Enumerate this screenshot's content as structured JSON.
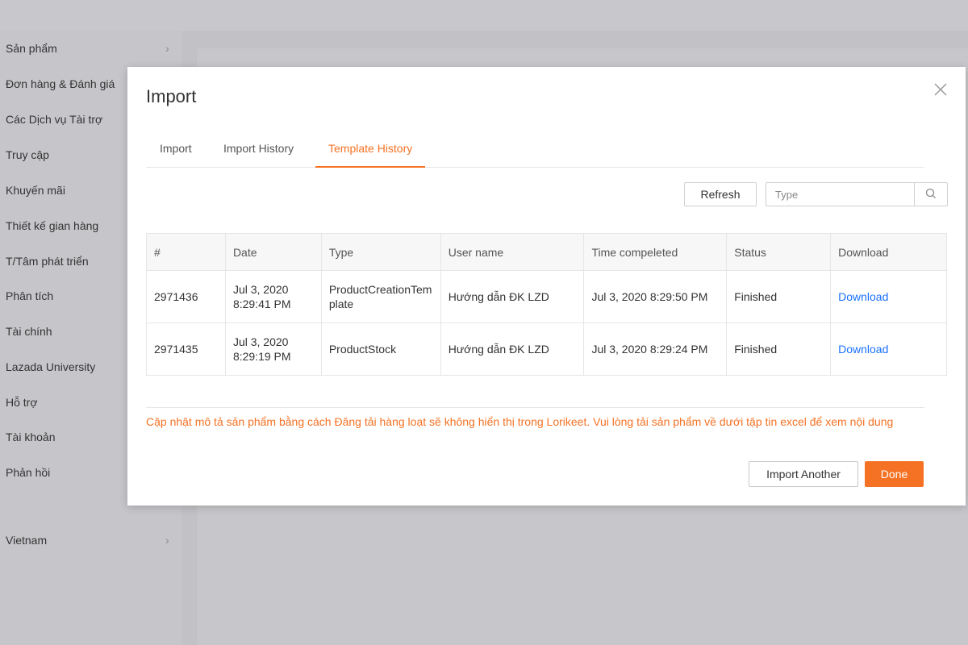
{
  "sidebar": {
    "items": [
      {
        "label": "Sản phẩm",
        "has_chevron": true
      },
      {
        "label": "Đơn hàng & Đánh giá"
      },
      {
        "label": "Các Dịch vụ Tài trợ"
      },
      {
        "label": "Truy cập"
      },
      {
        "label": "Khuyến mãi"
      },
      {
        "label": "Thiết kế gian hàng"
      },
      {
        "label": "T/Tâm phát triển"
      },
      {
        "label": "Phân tích"
      },
      {
        "label": "Tài chính"
      },
      {
        "label": "Lazada University"
      },
      {
        "label": "Hỗ trợ"
      },
      {
        "label": "Tài khoản"
      },
      {
        "label": "Phản hồi"
      }
    ],
    "footer_item": {
      "label": "Vietnam",
      "has_chevron": true
    },
    "chevron_glyph": "›"
  },
  "modal": {
    "title": "Import",
    "close_icon": "close-icon",
    "tabs": [
      {
        "label": "Import",
        "active": false
      },
      {
        "label": "Import History",
        "active": false
      },
      {
        "label": "Template History",
        "active": true
      }
    ],
    "refresh_label": "Refresh",
    "search": {
      "placeholder": "Type",
      "value": "",
      "icon": "search-icon"
    },
    "table": {
      "columns": [
        "#",
        "Date",
        "Type",
        "User name",
        "Time compeleted",
        "Status",
        "Download"
      ],
      "rows": [
        {
          "id": "2971436",
          "date_line1": "Jul 3, 2020",
          "date_line2": "8:29:41 PM",
          "type": "ProductCreationTemplate",
          "user": "Hướng dẫn ĐK LZD",
          "time_completed": "Jul 3, 2020 8:29:50 PM",
          "status": "Finished",
          "download": "Download"
        },
        {
          "id": "2971435",
          "date_line1": "Jul 3, 2020",
          "date_line2": "8:29:19 PM",
          "type": "ProductStock",
          "user": "Hướng dẫn ĐK LZD",
          "time_completed": "Jul 3, 2020 8:29:24 PM",
          "status": "Finished",
          "download": "Download"
        }
      ]
    },
    "notice": "Cập nhật mô tả sản phẩm bằng cách Đăng tải hàng loạt sẽ không hiển thị trong Lorikeet. Vui lòng tải sản phẩm về dưới tập tin excel để xem nội dung",
    "import_another_label": "Import Another",
    "done_label": "Done"
  },
  "colors": {
    "accent": "#f57224",
    "link": "#1a71ff",
    "overlay": "#c4c4c8"
  }
}
